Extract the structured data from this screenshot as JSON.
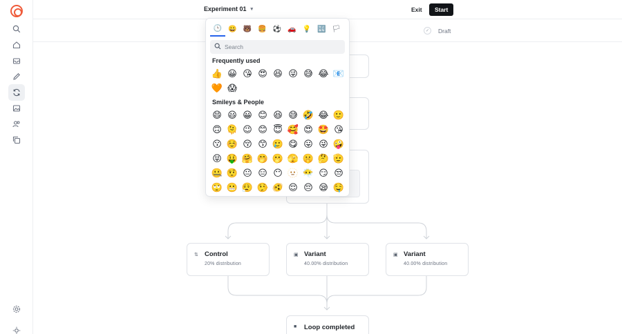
{
  "topbar": {
    "title": "Experiment 01",
    "exit_label": "Exit",
    "start_label": "Start"
  },
  "subbar": {
    "status": "Draft"
  },
  "rail": {
    "icons": [
      "search-icon",
      "home-icon",
      "inbox-icon",
      "edit-icon",
      "refresh-icon",
      "image-icon",
      "users-icon",
      "copy-icon",
      "settings-icon",
      "theme-icon"
    ]
  },
  "picker": {
    "search_placeholder": "Search",
    "tabs": [
      "🕒",
      "😀",
      "🐻",
      "🍔",
      "⚽",
      "🚗",
      "💡",
      "🔣",
      "🏳"
    ],
    "frequently_used_title": "Frequently used",
    "frequently_used": [
      "👍",
      "😀",
      "😘",
      "😍",
      "😆",
      "😜",
      "😅",
      "😂",
      "📧",
      "🧡",
      "😱"
    ],
    "smileys_title": "Smileys & People",
    "smileys": [
      "😄",
      "😃",
      "😀",
      "😊",
      "😆",
      "😅",
      "🤣",
      "😂",
      "🙂",
      "🙃",
      "🫠",
      "😉",
      "😊",
      "😇",
      "🥰",
      "😍",
      "🤩",
      "😘",
      "😗",
      "☺️",
      "😚",
      "😙",
      "🥲",
      "😋",
      "😛",
      "😜",
      "🤪",
      "😝",
      "🤑",
      "🤗",
      "🤭",
      "🫢",
      "🫣",
      "🤫",
      "🤔",
      "🫡",
      "🤐",
      "🤨",
      "😐",
      "😑",
      "😶",
      "🫥",
      "😶‍🌫️",
      "😏",
      "😒",
      "🙄",
      "😬",
      "😮‍💨",
      "🤥",
      "🫨",
      "😌",
      "😔",
      "😪",
      "🤤"
    ]
  },
  "canvas": {
    "nodes": [
      {
        "title": "Control",
        "sub": "20% distribution",
        "icon": "⇅"
      },
      {
        "title": "Variant",
        "sub": "40.00% distribution",
        "icon": "▣"
      },
      {
        "title": "Variant",
        "sub": "40.00% distribution",
        "icon": "▣"
      },
      {
        "title": "Loop completed",
        "sub": "",
        "icon": "■"
      }
    ]
  }
}
